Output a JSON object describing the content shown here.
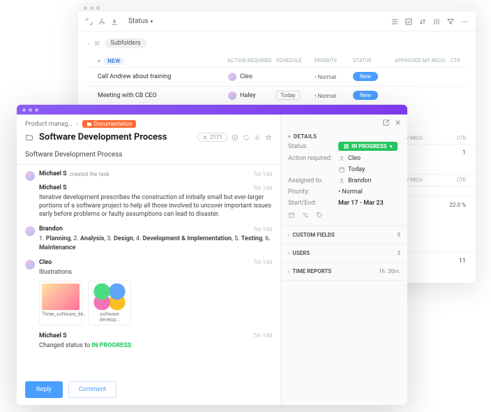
{
  "back": {
    "status_label": "Status",
    "subfolders": "Subfolders",
    "columns": {
      "new": "NEW",
      "action": "ACTION REQUIRED",
      "schedule": "SCHEDULE",
      "priority": "PRIORITY",
      "status": "STATUS",
      "approved": "APPROVED MY MICH.",
      "ctr": "CTR"
    },
    "rows": [
      {
        "name": "Call Andrew about training",
        "assignee": "Cleo",
        "schedule": "",
        "priority": "• Normal",
        "status": "New",
        "ctr": ""
      },
      {
        "name": "Meeting with CB CEO",
        "assignee": "Haley",
        "schedule": "Today",
        "priority": "• Normal",
        "status": "New",
        "ctr": ""
      }
    ],
    "extra_head": {
      "approved": "V MICH.",
      "ctr": "CTR"
    },
    "extra_rows": [
      {
        "ctr": "1"
      },
      {
        "ctr": ""
      },
      {
        "ctr": "",
        "pct": "22.0 %"
      },
      {
        "ctr": "11"
      }
    ]
  },
  "front": {
    "crumb1": "Product manag…",
    "crumb2": "Documentation",
    "title": "Software Development Process",
    "count": "2171",
    "subtitle": "Software Development Process",
    "activity": [
      {
        "author": "Michael S",
        "meta": "created the task",
        "time": "7m 14d",
        "body": ""
      },
      {
        "author": "Michael S",
        "meta": "",
        "time": "7m 14d",
        "body": "Iterative development prescribes the construction of initially small but ever-larger portions of a software project to help all those involved to uncover important issues early before problems or faulty assumptions can lead to disaster."
      },
      {
        "author": "Brandon",
        "meta": "",
        "time": "7m 14d",
        "body_html": "1. <b>Planning</b>, 2. <b>Analysis</b>, 3. <b>Design</b>, 4. <b>Development & Implementation</b>, 5. <b>Testing</b>, 6. <b>Maintenance</b>"
      },
      {
        "author": "Cleo",
        "meta": "",
        "time": "7m 14d",
        "body": "Illustrations",
        "thumbs": [
          "Three_software_de…",
          "software develop…"
        ]
      },
      {
        "author": "Michael S",
        "meta": "",
        "time": "7m 14d",
        "body_html": "Changed status to <span class='in-progress'>IN PROGRESS</span>"
      }
    ],
    "reply": "Reply",
    "comment": "Comment"
  },
  "details": {
    "title": "DETAILS",
    "status_label": "Status:",
    "status_value": "IN PROGRESS",
    "action_label": "Action required:",
    "action_person": "Cleo",
    "action_date": "Today",
    "assigned_label": "Assigned to:",
    "assigned_value": "Brandon",
    "priority_label": "Priority:",
    "priority_value": "• Normal",
    "startend_label": "Start/End:",
    "startend_value": "Mar 17 - Mar 23",
    "custom_fields": "CUSTOM FIELDS",
    "custom_fields_n": "5",
    "users": "USERS",
    "users_n": "3",
    "time_reports": "TIME REPORTS",
    "time_reports_v": "1h. 30m."
  }
}
